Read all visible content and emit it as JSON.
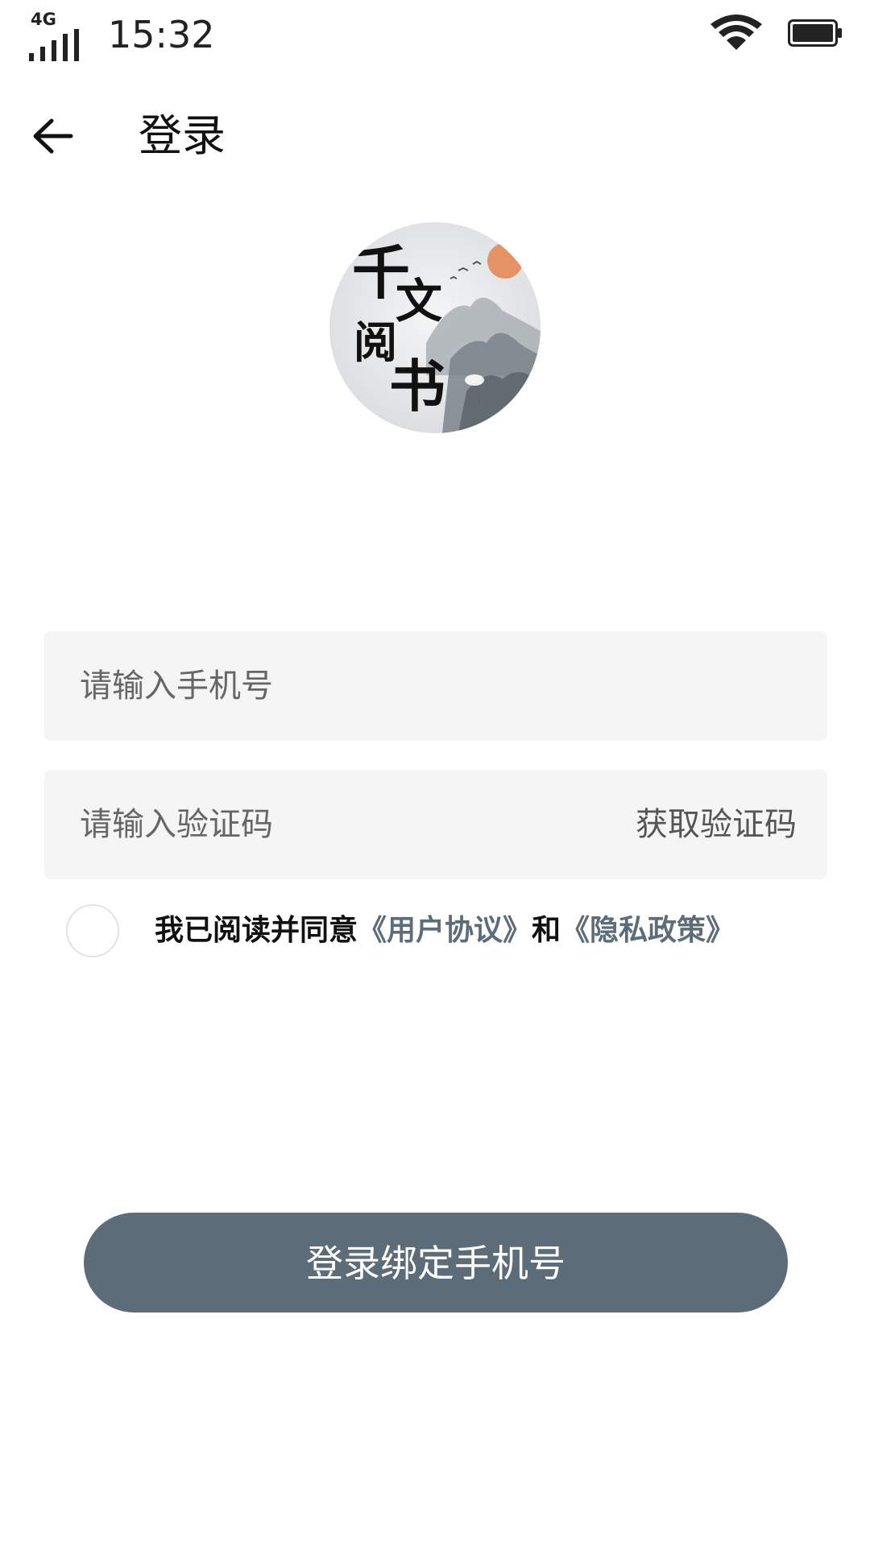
{
  "status_bar": {
    "network": "4G",
    "time": "15:32",
    "icons": [
      "signal-icon",
      "wifi-icon",
      "battery-icon"
    ]
  },
  "header": {
    "back_icon": "arrow-left-icon",
    "title": "登录"
  },
  "logo": {
    "text_chars": [
      "千",
      "文",
      "阅",
      "书"
    ],
    "description_icon": "app-logo"
  },
  "form": {
    "phone_placeholder": "请输入手机号",
    "code_placeholder": "请输入验证码",
    "get_code_label": "获取验证码"
  },
  "agreement": {
    "prefix": "我已阅读并同意",
    "user_agreement": "《用户协议》",
    "conjunction": "和",
    "privacy_policy": "《隐私政策》"
  },
  "actions": {
    "login_label": "登录绑定手机号"
  },
  "colors": {
    "accent": "#5c6c78",
    "input_bg": "#f5f5f5",
    "background": "#ffffff"
  }
}
